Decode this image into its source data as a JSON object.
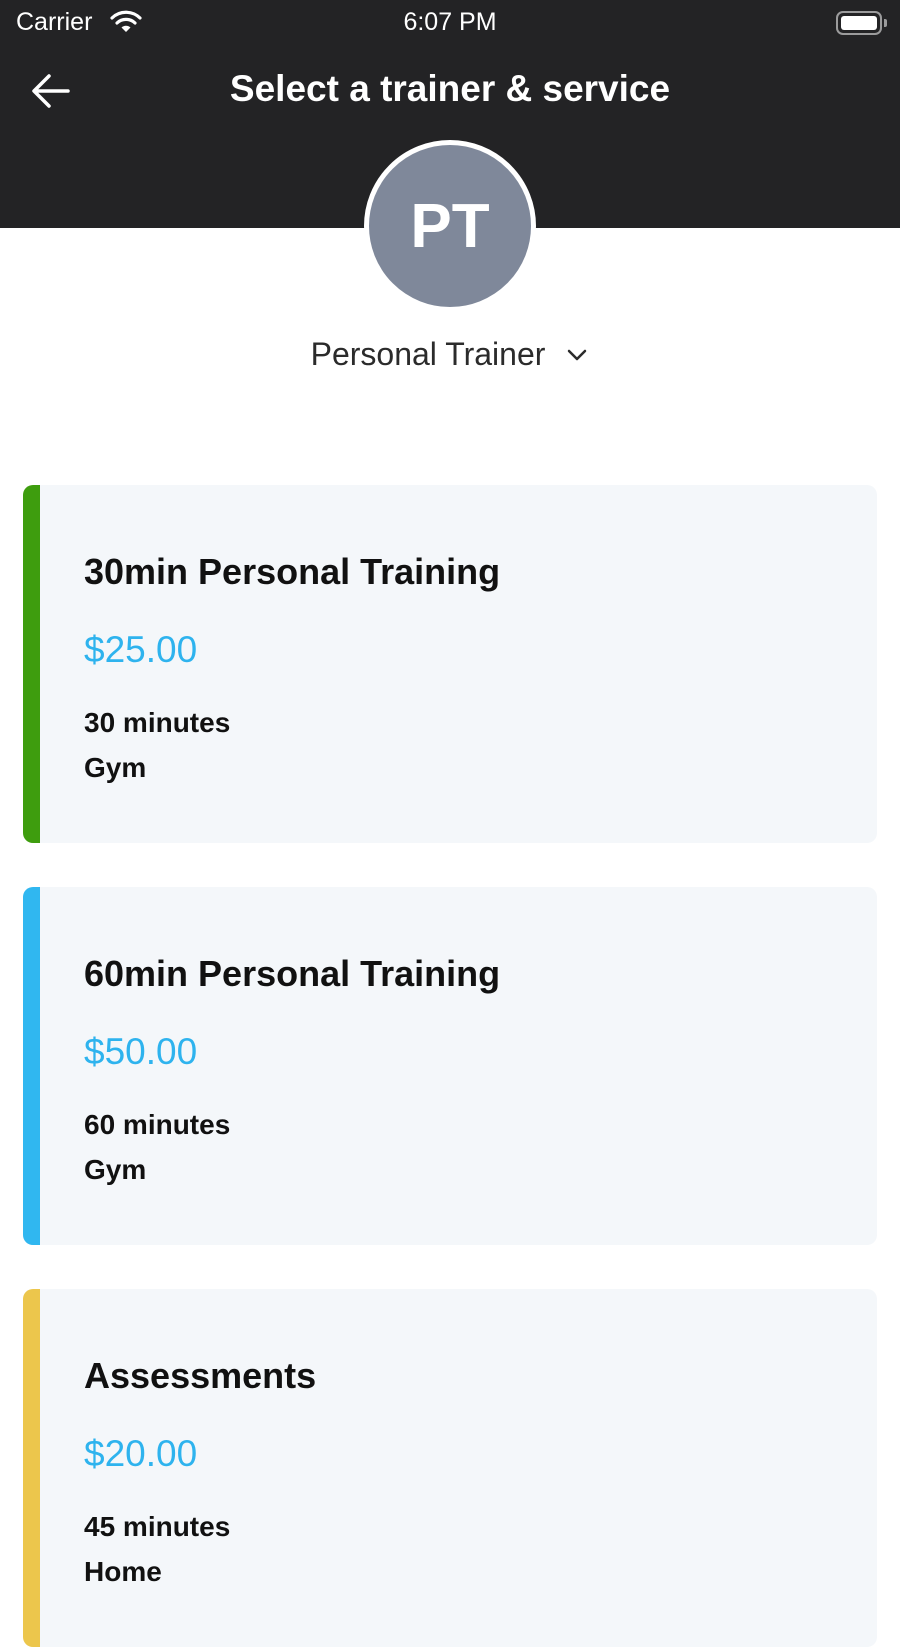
{
  "status_bar": {
    "carrier": "Carrier",
    "time": "6:07 PM"
  },
  "header": {
    "title": "Select a trainer & service",
    "background": "#232325"
  },
  "trainer": {
    "initials": "PT",
    "name": "Personal Trainer",
    "avatar_color": "#7f889a"
  },
  "services": [
    {
      "title": "30min Personal Training",
      "price": "$25.00",
      "duration": "30 minutes",
      "location": "Gym",
      "accent": "#3e9d0e"
    },
    {
      "title": "60min Personal Training",
      "price": "$50.00",
      "duration": "60 minutes",
      "location": "Gym",
      "accent": "#30b7f0"
    },
    {
      "title": "Assessments",
      "price": "$20.00",
      "duration": "45 minutes",
      "location": "Home",
      "accent": "#ecc64c"
    }
  ],
  "colors": {
    "price": "#2eb3ee",
    "card_background": "#f4f7fa"
  },
  "icons": {
    "back": "arrow-left-icon",
    "dropdown": "chevron-down-icon",
    "wifi": "wifi-icon",
    "battery": "battery-icon"
  }
}
